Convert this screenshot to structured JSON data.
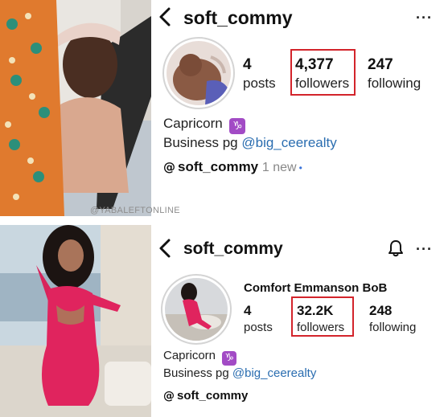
{
  "watermark": "@YABALEFTONLINE",
  "top_profile": {
    "username": "soft_commy",
    "more_icon": "more-horizontal-icon",
    "posts": {
      "count": "4",
      "label": "posts"
    },
    "followers": {
      "count": "4,377",
      "label": "followers"
    },
    "following": {
      "count": "247",
      "label": "following"
    },
    "bio_line1": "Capricorn",
    "zodiac_glyph": "♑",
    "bio_prefix": "Business pg",
    "bio_mention": "@big_ceerealty",
    "threads_name": "soft_commy",
    "threads_new": "1 new",
    "highlight_color": "#d3242b"
  },
  "bottom_profile": {
    "username": "soft_commy",
    "more_icon": "more-horizontal-icon",
    "bell_icon": "bell-icon",
    "full_name": "Comfort Emmanson BoB",
    "posts": {
      "count": "4",
      "label": "posts"
    },
    "followers": {
      "count": "32.2K",
      "label": "followers"
    },
    "following": {
      "count": "248",
      "label": "following"
    },
    "bio_line1": "Capricorn",
    "zodiac_glyph": "♑",
    "bio_prefix": "Business pg",
    "bio_mention": "@big_ceerealty",
    "threads_name": "soft_commy",
    "highlight_color": "#d3242b"
  }
}
